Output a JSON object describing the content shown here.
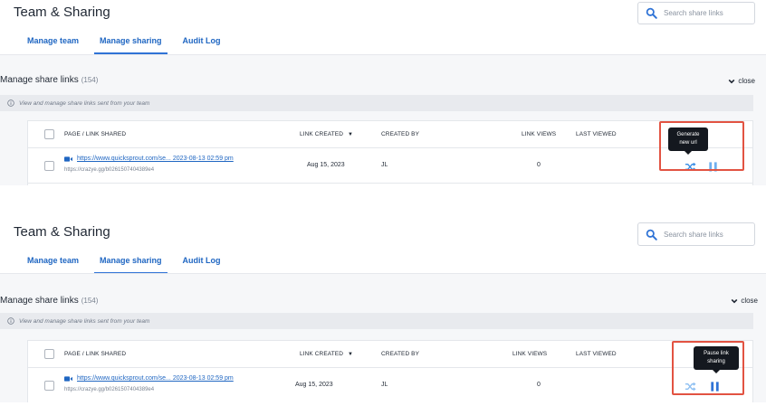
{
  "header": {
    "title": "Team & Sharing"
  },
  "search": {
    "placeholder": "Search share links"
  },
  "tabs": [
    {
      "label": "Manage team"
    },
    {
      "label": "Manage sharing"
    },
    {
      "label": "Audit Log"
    }
  ],
  "section": {
    "title": "Manage share links",
    "count": "(154)",
    "close_label": "close",
    "info": "View and manage share links sent from your team"
  },
  "table": {
    "columns": {
      "page": "PAGE / LINK SHARED",
      "created": "LINK CREATED",
      "created_by": "CREATED BY",
      "views": "LINK VIEWS",
      "last_viewed": "LAST VIEWED"
    },
    "row": {
      "link": "https://www.quicksprout.com/se... 2023-08-13 02:59 pm",
      "short_url": "https://crazye.gg/b0261507404389e4",
      "created": "Aug 15, 2023",
      "created_by": "JL",
      "views": "0",
      "last_viewed": ""
    }
  },
  "tooltips": {
    "generate": "Generate new url",
    "pause": "Pause link sharing"
  },
  "colors": {
    "accent": "#1f66c2",
    "highlight": "#e25342",
    "tooltip_bg": "#14181f",
    "shuffle_icon": "#3b8fe6",
    "pause_icon": "#2f73d6"
  },
  "icons": [
    "search-icon",
    "chevron-down-icon",
    "info-icon",
    "video-icon",
    "shuffle-icon",
    "pause-icon",
    "sort-caret-icon"
  ]
}
